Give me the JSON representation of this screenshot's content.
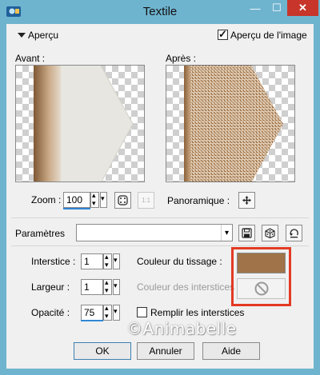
{
  "window": {
    "title": "Textile"
  },
  "preview_section": {
    "header": "Aperçu",
    "show_preview_label": "Aperçu de l'image",
    "show_preview_checked": true,
    "before_label": "Avant :",
    "after_label": "Après :",
    "zoom_label": "Zoom :",
    "zoom_value": "100",
    "pan_label": "Panoramique :"
  },
  "settings": {
    "presets_label": "Paramètres",
    "presets_value": "",
    "interstice_label": "Interstice :",
    "interstice_value": "1",
    "width_label": "Largeur :",
    "width_value": "1",
    "opacity_label": "Opacité :",
    "opacity_value": "75",
    "weave_color_label": "Couleur du tissage :",
    "gap_color_label": "Couleur des interstices",
    "fill_gaps_label": "Remplir les interstices",
    "fill_gaps_checked": false
  },
  "colors": {
    "weave_color": "#a07348",
    "highlight_frame": "#e33a23",
    "accent": "#2f87d6"
  },
  "buttons": {
    "ok": "OK",
    "cancel": "Annuler",
    "help": "Aide"
  },
  "watermark": "©Animabelle"
}
